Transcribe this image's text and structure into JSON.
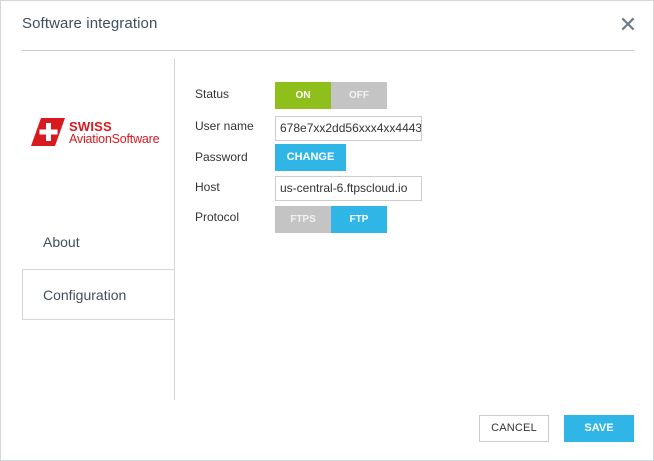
{
  "dialog": {
    "title": "Software integration",
    "close_icon": "close-icon"
  },
  "logo": {
    "brand_word": "SWISS",
    "sub_text": "AviationSoftware",
    "color": "#d71920"
  },
  "sidebar": {
    "items": [
      {
        "label": "About",
        "active": false
      },
      {
        "label": "Configuration",
        "active": true
      }
    ]
  },
  "form": {
    "status": {
      "label": "Status",
      "on_label": "ON",
      "off_label": "OFF",
      "value": "ON"
    },
    "username": {
      "label": "User name",
      "value": "678e7xx2dd56xxx4xx4443"
    },
    "password": {
      "label": "Password",
      "button_label": "CHANGE"
    },
    "host": {
      "label": "Host",
      "value": "us-central-6.ftpscloud.io"
    },
    "protocol": {
      "label": "Protocol",
      "options": [
        "FTPS",
        "FTP"
      ],
      "selected": "FTP"
    }
  },
  "footer": {
    "cancel_label": "CANCEL",
    "save_label": "SAVE"
  },
  "colors": {
    "accent": "#2fb5e6",
    "on_green": "#8fbf1a",
    "inactive_grey": "#c4c4c4"
  }
}
